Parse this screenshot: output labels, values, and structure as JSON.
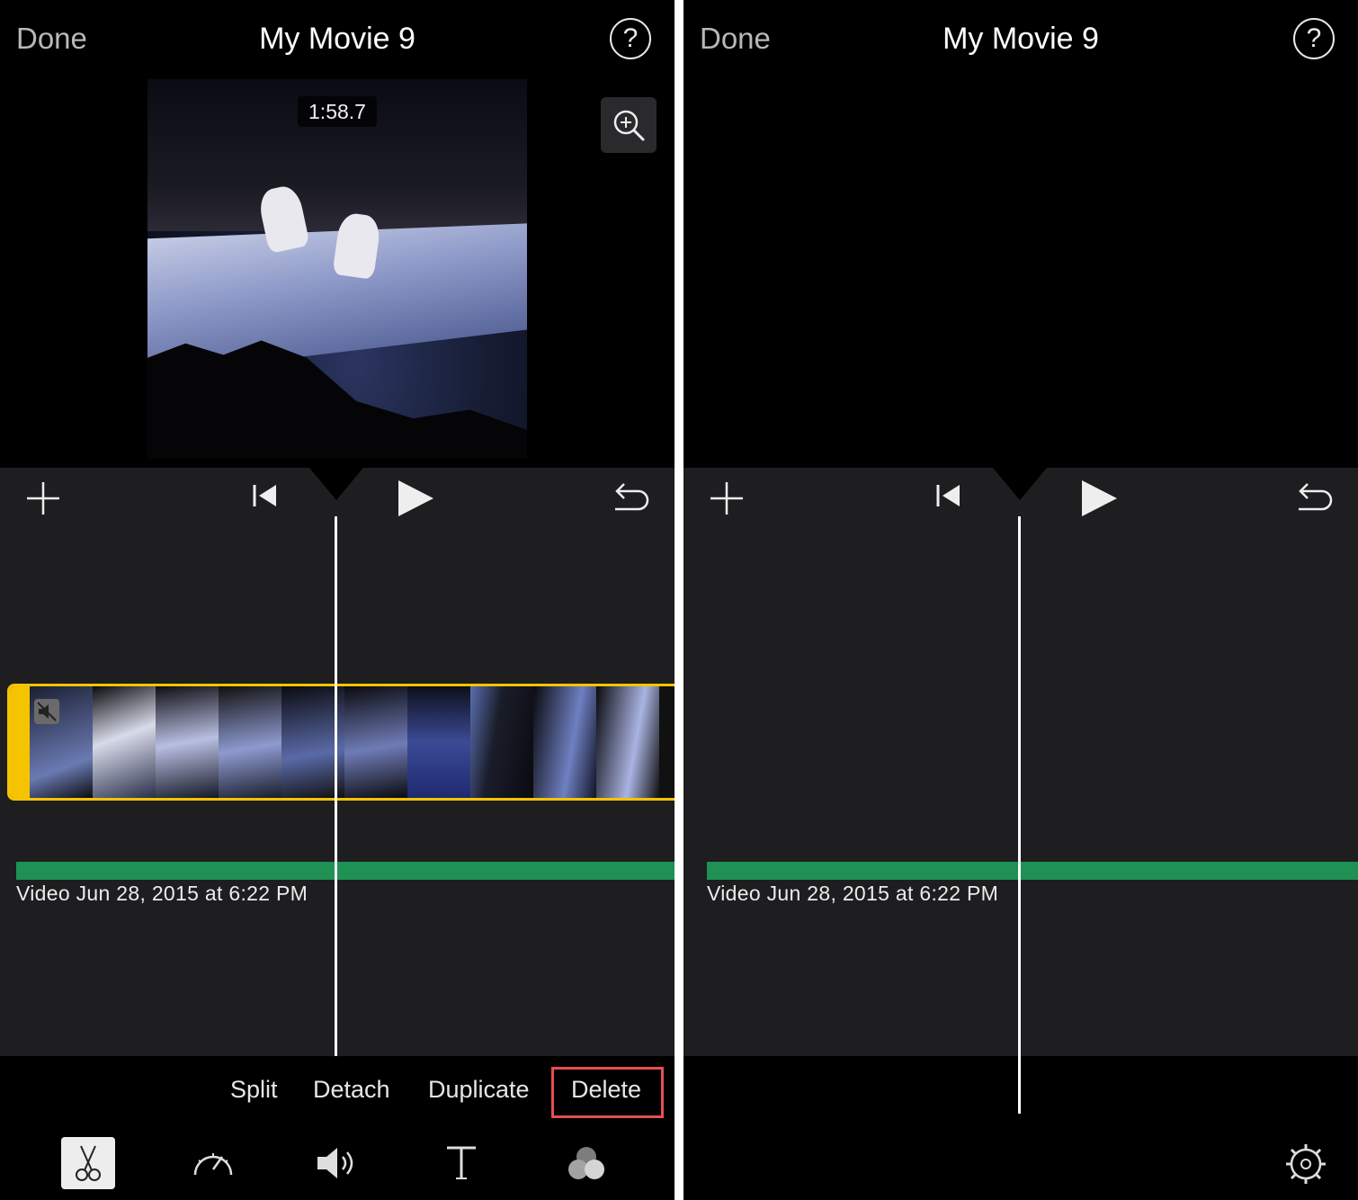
{
  "left": {
    "nav": {
      "done_label": "Done",
      "title": "My Movie 9",
      "help_label": "?"
    },
    "viewer": {
      "timecode": "1:58.7",
      "zoom_icon": "zoom-in-icon"
    },
    "controls": {
      "add_icon": "plus-icon",
      "rewind_icon": "skip-to-start-icon",
      "play_icon": "play-icon",
      "undo_icon": "undo-icon"
    },
    "clip": {
      "mute_icon": "mute-icon",
      "selected_color": "#f5c400"
    },
    "audio": {
      "label": "Video Jun 28, 2015 at 6:22 PM",
      "color": "#1f9154"
    },
    "actions": [
      {
        "label": "Split"
      },
      {
        "label": "Detach"
      },
      {
        "label": "Duplicate"
      },
      {
        "label": "Delete",
        "highlighted": true
      }
    ],
    "highlight_color": "#e5504f",
    "tools": [
      {
        "icon": "scissors-icon",
        "selected": true
      },
      {
        "icon": "speed-icon",
        "selected": false
      },
      {
        "icon": "volume-icon",
        "selected": false
      },
      {
        "icon": "text-icon",
        "selected": false
      },
      {
        "icon": "filters-icon",
        "selected": false
      }
    ]
  },
  "right": {
    "nav": {
      "done_label": "Done",
      "title": "My Movie 9",
      "help_label": "?"
    },
    "controls": {
      "add_icon": "plus-icon",
      "rewind_icon": "skip-to-start-icon",
      "play_icon": "play-icon",
      "undo_icon": "undo-icon"
    },
    "audio": {
      "label": "Video Jun 28, 2015 at 6:22 PM",
      "color": "#1f9154"
    },
    "settings_icon": "settings-gear-icon"
  }
}
